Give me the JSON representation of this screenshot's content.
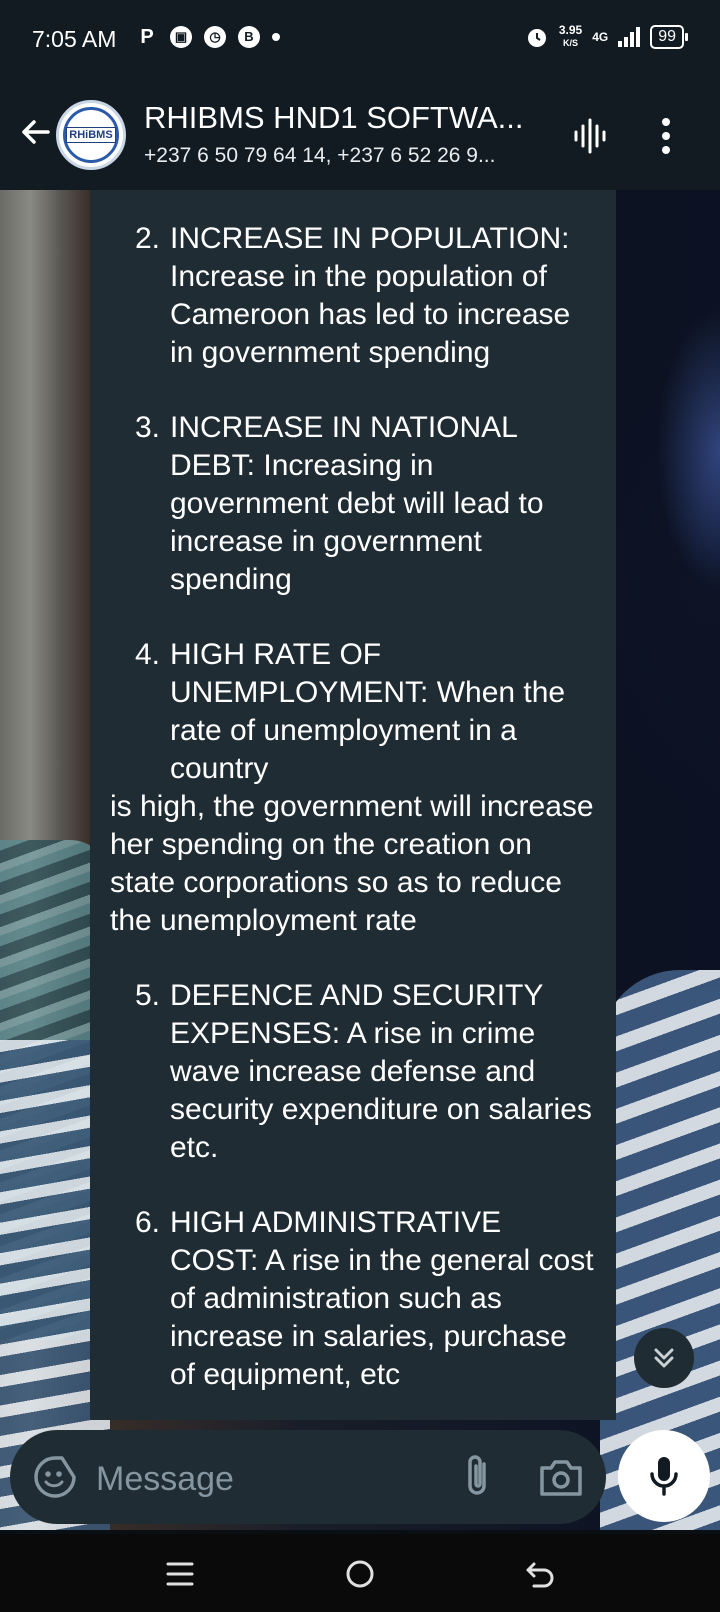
{
  "status_bar": {
    "time": "7:05 AM",
    "left_icons": [
      "parking-icon",
      "message-icon",
      "alarm-icon",
      "b-icon",
      "dot-icon"
    ],
    "net_speed_value": "3.95",
    "net_speed_unit": "K/S",
    "network_type": "4G",
    "battery": "99"
  },
  "header": {
    "title": "RHIBMS HND1 SOFTWA...",
    "subtitle": "+237 6 50 79 64 14, +237 6 52 26 9...",
    "avatar_logo_text": "RHiBMS"
  },
  "message": {
    "items": [
      {
        "num": "2.",
        "text": "INCREASE IN POPULATION: Increase in the population of Cameroon has led to increase in government spending"
      },
      {
        "num": "3.",
        "text": "INCREASE IN NATIONAL DEBT: Increasing in government debt will lead to increase in government spending"
      },
      {
        "num": "4.",
        "text": "HIGH RATE OF UNEMPLOYMENT: When the rate of unemployment in a country"
      }
    ],
    "continuation": "is high, the government will increase her spending on the creation on state corporations so as to reduce the unemployment rate",
    "items2": [
      {
        "num": "5.",
        "text": "DEFENCE AND SECURITY EXPENSES: A rise in crime wave increase defense and security expenditure on salaries etc."
      },
      {
        "num": "6.",
        "text": "HIGH ADMINISTRATIVE COST: A rise in the general cost of administration such as increase in salaries, purchase of equipment, etc"
      }
    ]
  },
  "input": {
    "placeholder": "Message"
  },
  "colors": {
    "header_bg": "#111b21",
    "bubble_bg": "#202c33",
    "placeholder": "#8696a0"
  }
}
